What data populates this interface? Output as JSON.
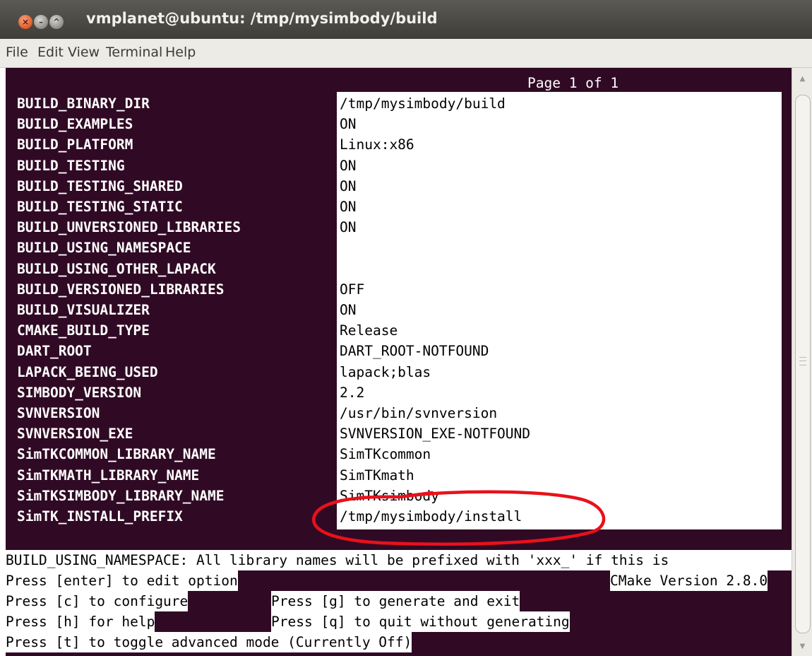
{
  "window": {
    "title": "vmplanet@ubuntu: /tmp/mysimbody/build",
    "close_glyph": "×",
    "min_glyph": "–",
    "max_glyph": "^"
  },
  "menu": [
    "File",
    "Edit",
    "View",
    "Terminal",
    "Help"
  ],
  "terminal": {
    "page_label": "Page 1 of 1",
    "entries": [
      {
        "key": "BUILD_BINARY_DIR",
        "value": "/tmp/mysimbody/build"
      },
      {
        "key": "BUILD_EXAMPLES",
        "value": "ON"
      },
      {
        "key": "BUILD_PLATFORM",
        "value": "Linux:x86"
      },
      {
        "key": "BUILD_TESTING",
        "value": "ON"
      },
      {
        "key": "BUILD_TESTING_SHARED",
        "value": "ON"
      },
      {
        "key": "BUILD_TESTING_STATIC",
        "value": "ON"
      },
      {
        "key": "BUILD_UNVERSIONED_LIBRARIES",
        "value": "ON"
      },
      {
        "key": "BUILD_USING_NAMESPACE",
        "value": ""
      },
      {
        "key": "BUILD_USING_OTHER_LAPACK",
        "value": ""
      },
      {
        "key": "BUILD_VERSIONED_LIBRARIES",
        "value": "OFF"
      },
      {
        "key": "BUILD_VISUALIZER",
        "value": "ON"
      },
      {
        "key": "CMAKE_BUILD_TYPE",
        "value": "Release"
      },
      {
        "key": "DART_ROOT",
        "value": "DART_ROOT-NOTFOUND"
      },
      {
        "key": "LAPACK_BEING_USED",
        "value": "lapack;blas"
      },
      {
        "key": "SIMBODY_VERSION",
        "value": "2.2"
      },
      {
        "key": "SVNVERSION",
        "value": "/usr/bin/svnversion"
      },
      {
        "key": "SVNVERSION_EXE",
        "value": "SVNVERSION_EXE-NOTFOUND"
      },
      {
        "key": "SimTKCOMMON_LIBRARY_NAME",
        "value": "SimTKcommon"
      },
      {
        "key": "SimTKMATH_LIBRARY_NAME",
        "value": "SimTKmath"
      },
      {
        "key": "SimTKSIMBODY_LIBRARY_NAME",
        "value": "SimTKsimbody"
      },
      {
        "key": "SimTK_INSTALL_PREFIX",
        "value": "/tmp/mysimbody/install"
      }
    ],
    "status": "BUILD_USING_NAMESPACE: All library names will be prefixed with 'xxx_' if this is",
    "help": {
      "edit": "Press [enter] to edit option",
      "version": "CMake Version 2.8.0",
      "configure": "Press [c] to configure",
      "generate": "Press [g] to generate and exit",
      "help": "Press [h] for help",
      "quit": "Press [q] to quit without generating",
      "toggle": "Press [t] to toggle advanced mode (Currently Off)"
    }
  },
  "annotation_color": "#e8111b"
}
